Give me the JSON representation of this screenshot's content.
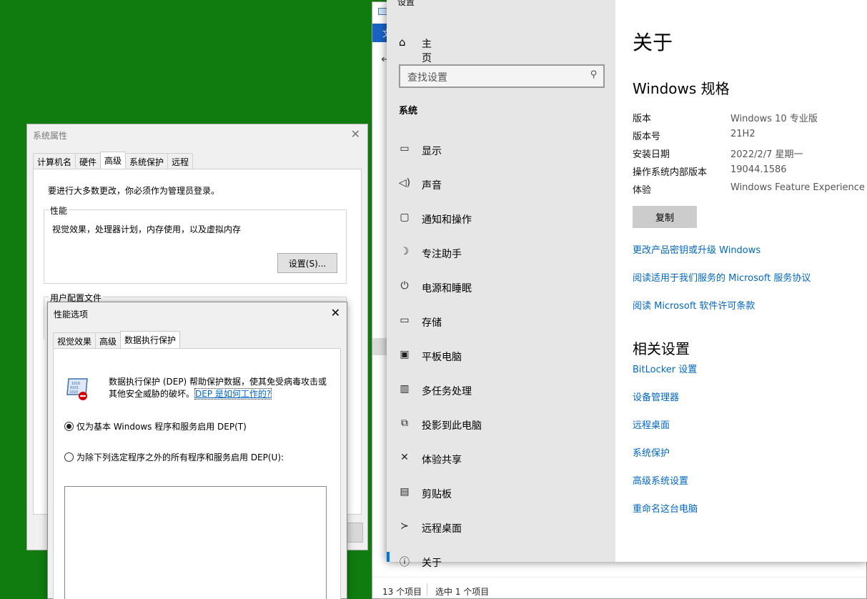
{
  "explorer": {
    "tab_fragment": "文",
    "status_items": "13 个项目",
    "status_selected": "选中 1 个项目"
  },
  "settings": {
    "window_title": "设置",
    "home_label": "主页",
    "search_placeholder": "查找设置",
    "section_title": "系统",
    "nav_items": [
      {
        "label": "显示",
        "icon": "display-icon"
      },
      {
        "label": "声音",
        "icon": "sound-icon"
      },
      {
        "label": "通知和操作",
        "icon": "notification-icon"
      },
      {
        "label": "专注助手",
        "icon": "moon-icon"
      },
      {
        "label": "电源和睡眠",
        "icon": "power-icon"
      },
      {
        "label": "存储",
        "icon": "storage-icon"
      },
      {
        "label": "平板电脑",
        "icon": "tablet-icon"
      },
      {
        "label": "多任务处理",
        "icon": "multitask-icon"
      },
      {
        "label": "投影到此电脑",
        "icon": "project-icon"
      },
      {
        "label": "体验共享",
        "icon": "share-icon"
      },
      {
        "label": "剪贴板",
        "icon": "clipboard-icon"
      },
      {
        "label": "远程桌面",
        "icon": "remote-desktop-icon"
      },
      {
        "label": "关于",
        "icon": "info-icon"
      }
    ],
    "about": {
      "title": "关于",
      "spec_title": "Windows 规格",
      "specs": [
        {
          "key": "版本",
          "value": "Windows 10 专业版"
        },
        {
          "key": "版本号",
          "value": "21H2"
        },
        {
          "key": "安装日期",
          "value": "2022/2/7 星期一"
        },
        {
          "key": "操作系统内部版本",
          "value": "19044.1586"
        },
        {
          "key": "体验",
          "value": "Windows Feature Experience Pa"
        }
      ],
      "copy_label": "复制",
      "links": [
        "更改产品密钥或升级 Windows",
        "阅读适用于我们服务的 Microsoft 服务协议",
        "阅读 Microsoft 软件许可条款"
      ],
      "related_title": "相关设置",
      "related_links": [
        "BitLocker 设置",
        "设备管理器",
        "远程桌面",
        "系统保护",
        "高级系统设置",
        "重命名这台电脑"
      ]
    }
  },
  "sysprops": {
    "title": "系统属性",
    "tabs": [
      "计算机名",
      "硬件",
      "高级",
      "系统保护",
      "远程"
    ],
    "admin_note": "要进行大多数更改，你必须作为管理员登录。",
    "perf_legend": "性能",
    "perf_desc": "视觉效果，处理器计划，内存使用，以及虚拟内存",
    "settings_button": "设置(S)...",
    "profiles_legend": "用户配置文件"
  },
  "perfopt": {
    "title": "性能选项",
    "tabs": [
      "视觉效果",
      "高级",
      "数据执行保护"
    ],
    "dep_desc_1": "数据执行保护 (DEP) 帮助保护数据，使其免受病毒攻击或",
    "dep_desc_2": "其他安全威胁的破坏。",
    "dep_link": "DEP 是如何工作的?",
    "radio_basic": "仅为基本 Windows 程序和服务启用 DEP(T)",
    "radio_all": "为除下列选定程序之外的所有程序和服务启用 DEP(U):",
    "selected_option": "basic"
  }
}
